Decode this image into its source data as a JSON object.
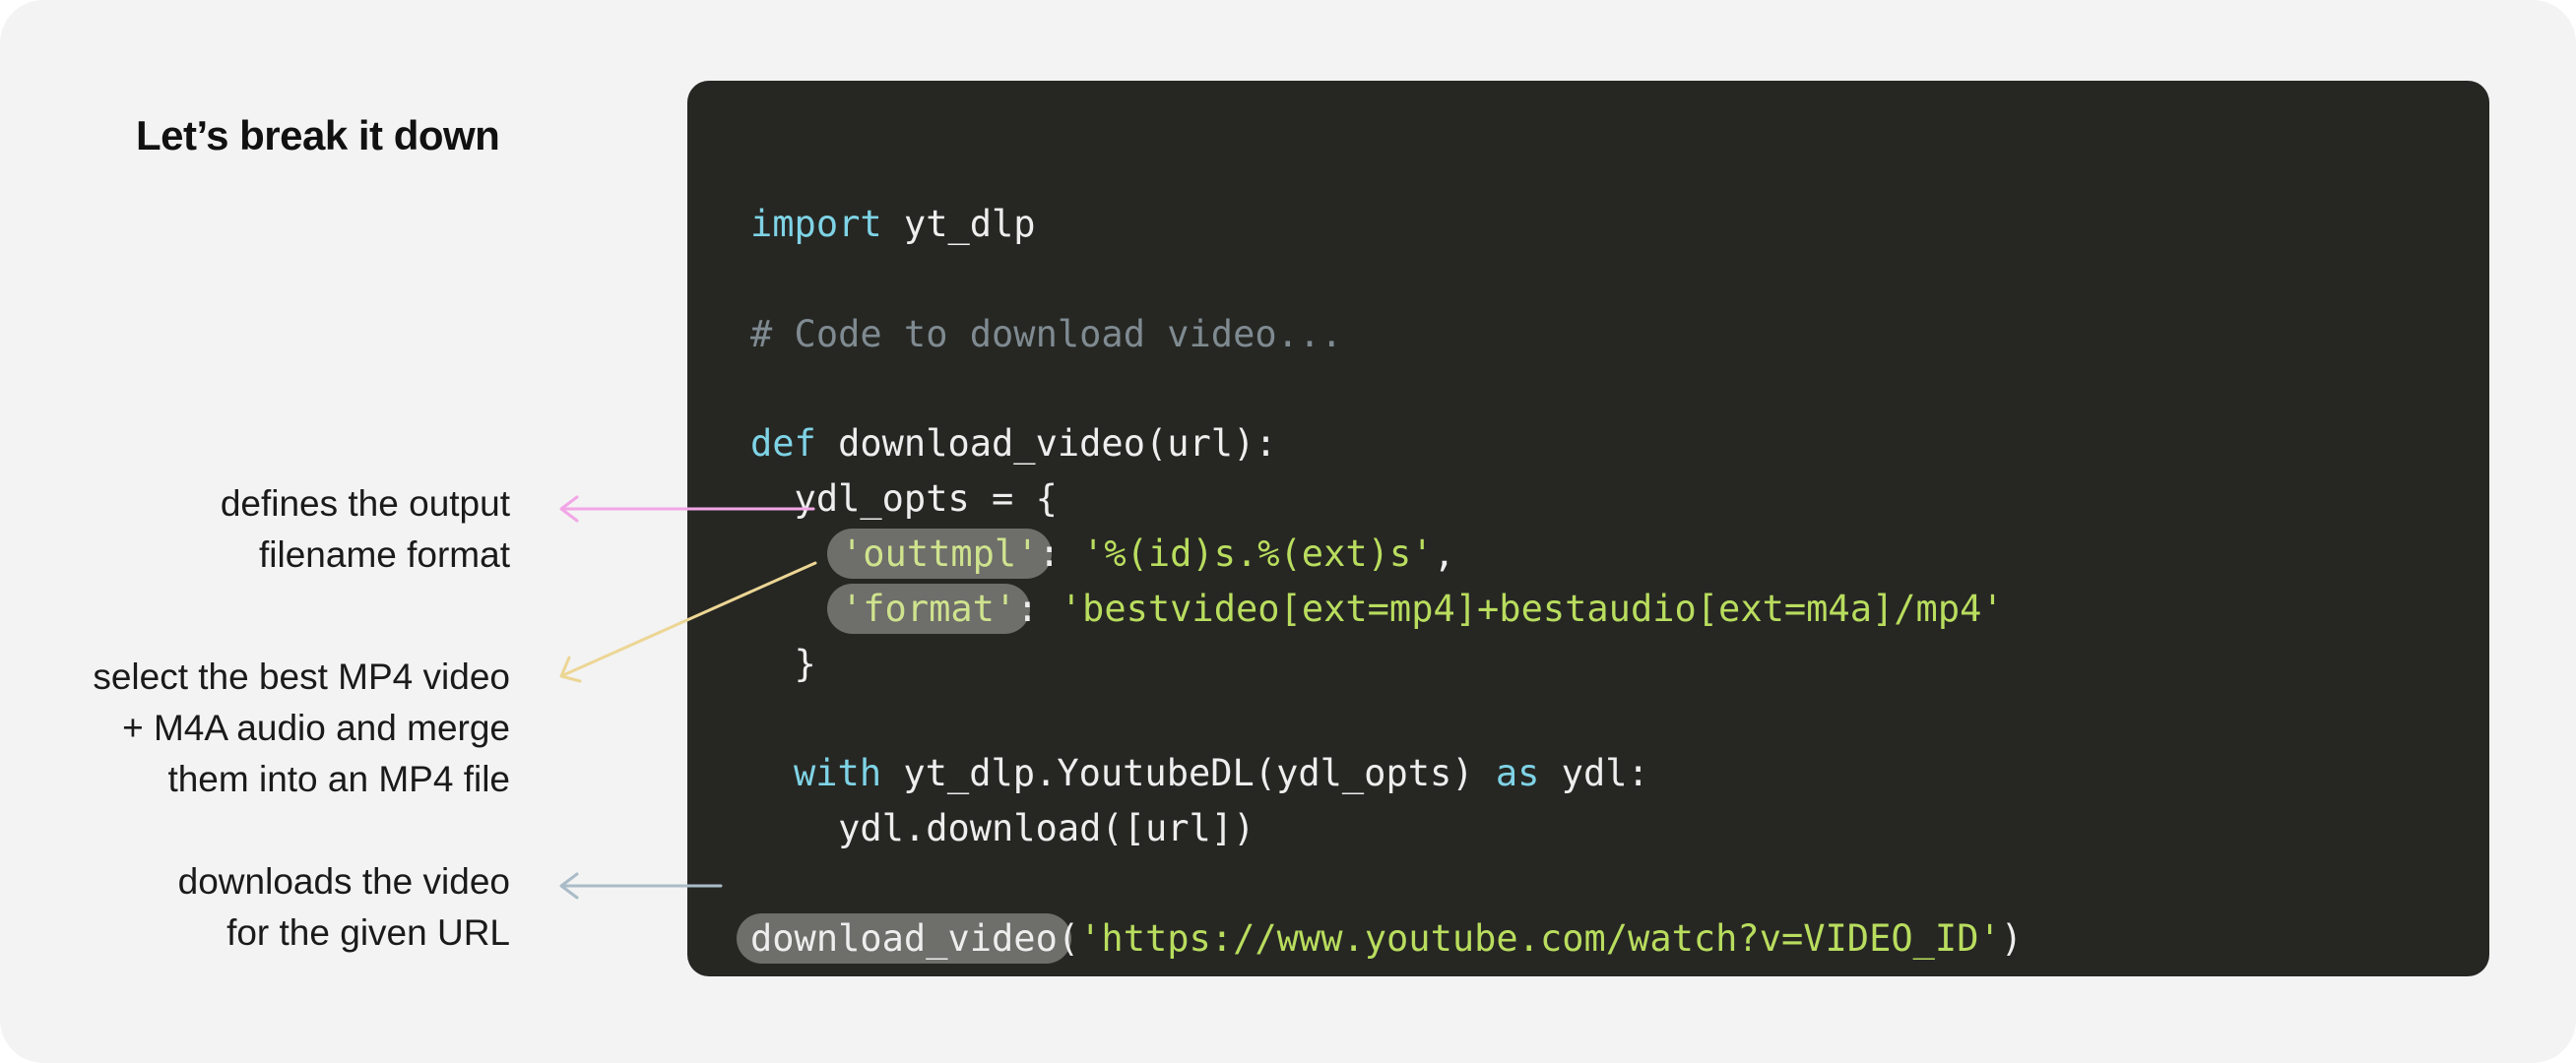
{
  "heading": "Let’s break it down",
  "annotations": {
    "outtmpl": [
      "defines the output",
      "filename format"
    ],
    "format": [
      "select the best MP4 video",
      "+ M4A audio and merge",
      "them into an MP4 file"
    ],
    "call": [
      "downloads the video",
      "for the given URL"
    ]
  },
  "code": {
    "import_kw": "import",
    "import_mod": " yt_dlp",
    "comment": "# Code to download video...",
    "def_kw": "def",
    "def_sig": " download_video(url):",
    "opts_open": "  ydl_opts = {",
    "outtmpl_key": "'outtmpl'",
    "outtmpl_colon": ": ",
    "outtmpl_val": "'%(id)s.%(ext)s'",
    "outtmpl_comma": ",",
    "format_key": "'format'",
    "format_colon": ": ",
    "format_val": "'bestvideo[ext=mp4]+bestaudio[ext=m4a]/mp4'",
    "opts_close": "  }",
    "with_kw": "with",
    "with_mid": " yt_dlp.YoutubeDL(ydl_opts) ",
    "as_kw": "as",
    "with_end": " ydl:",
    "download_line": "    ydl.download([url])",
    "call_fn": "download_video",
    "call_open": "(",
    "call_arg": "'https://www.youtube.com/watch?v=VIDEO_ID'",
    "call_close": ")"
  },
  "colors": {
    "arrow_outtmpl": "#f2a6e6",
    "arrow_format": "#ecd695",
    "arrow_call": "#a9bcc7"
  }
}
